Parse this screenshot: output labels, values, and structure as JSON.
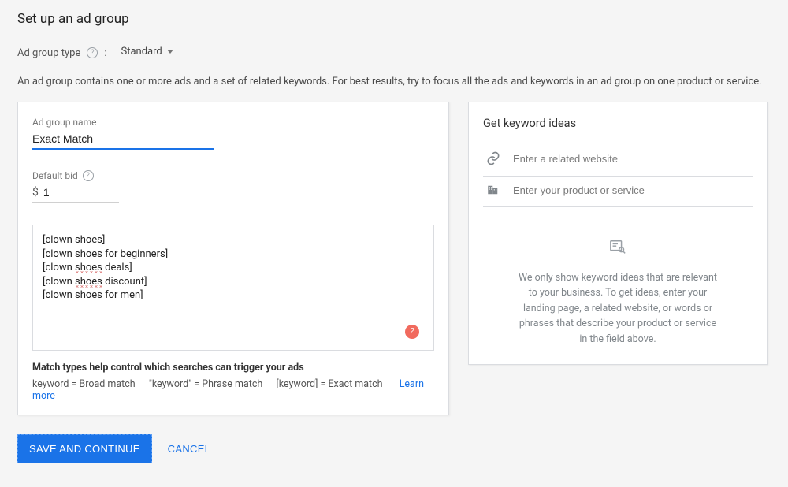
{
  "page_title": "Set up an ad group",
  "type_row": {
    "label": "Ad group type",
    "colon": ":",
    "value": "Standard"
  },
  "description": "An ad group contains one or more ads and a set of related keywords. For best results, try to focus all the ads and keywords in an ad group on one product or service.",
  "left": {
    "name_label": "Ad group name",
    "name_value": "Exact Match",
    "bid_label": "Default bid",
    "currency": "$",
    "bid_value": "1",
    "keywords": [
      "[clown shoes]",
      "[clown shoes for beginners]",
      "[clown shoes deals]",
      "[clown shoes discount]",
      "[clown shoes for men]"
    ],
    "badge_count": "2",
    "match_heading": "Match types help control which searches can trigger your ads",
    "broad": "keyword = Broad match",
    "phrase": "\"keyword\" = Phrase match",
    "exact": "[keyword] = Exact match",
    "learn_more": "Learn more"
  },
  "right": {
    "title": "Get keyword ideas",
    "website_placeholder": "Enter a related website",
    "product_placeholder": "Enter your product or service",
    "empty_text": "We only show keyword ideas that are relevant to your business. To get ideas, enter your landing page, a related website, or words or phrases that describe your product or service in the field above."
  },
  "footer": {
    "primary": "SAVE AND CONTINUE",
    "cancel": "CANCEL"
  }
}
